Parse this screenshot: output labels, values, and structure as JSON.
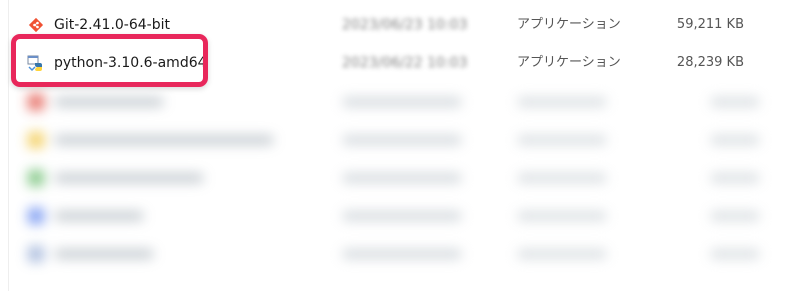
{
  "files": [
    {
      "name": "Git-2.41.0-64-bit",
      "date": "2023/06/23 10:03",
      "type": "アプリケーション",
      "size": "59,211 KB",
      "icon": "git-icon"
    },
    {
      "name": "python-3.10.6-amd64",
      "date": "2023/06/22 10:03",
      "type": "アプリケーション",
      "size": "28,239 KB",
      "icon": "python-installer-icon"
    }
  ],
  "blurred_rows": [
    {
      "icon_color": "#e2574c"
    },
    {
      "icon_color": "#f2c94c"
    },
    {
      "icon_color": "#6fbf73"
    },
    {
      "icon_color": "#6c8ff0"
    },
    {
      "icon_color": "#9fb3d9"
    }
  ],
  "highlight_color": "#e8275b"
}
